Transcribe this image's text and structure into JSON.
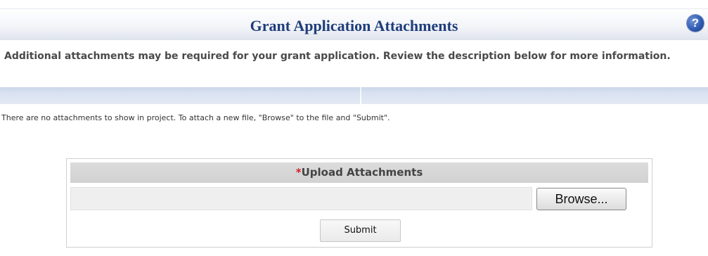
{
  "header": {
    "title": "Grant Application Attachments",
    "help_icon": "help-icon",
    "help_glyph": "?"
  },
  "description": "Additional attachments may be required for your grant application. Review the description below for more information.",
  "attachments_table": {
    "columns": [
      "",
      ""
    ],
    "empty_message": "There are no attachments to show in project. To attach a new file, \"Browse\" to the file and \"Submit\"."
  },
  "upload": {
    "required_marker": "*",
    "title": "Upload Attachments",
    "file_value": "",
    "browse_label": "Browse...",
    "submit_label": "Submit"
  },
  "colors": {
    "title": "#1f3d7a",
    "required": "#d22222",
    "table_header": "#d9e2f1"
  }
}
